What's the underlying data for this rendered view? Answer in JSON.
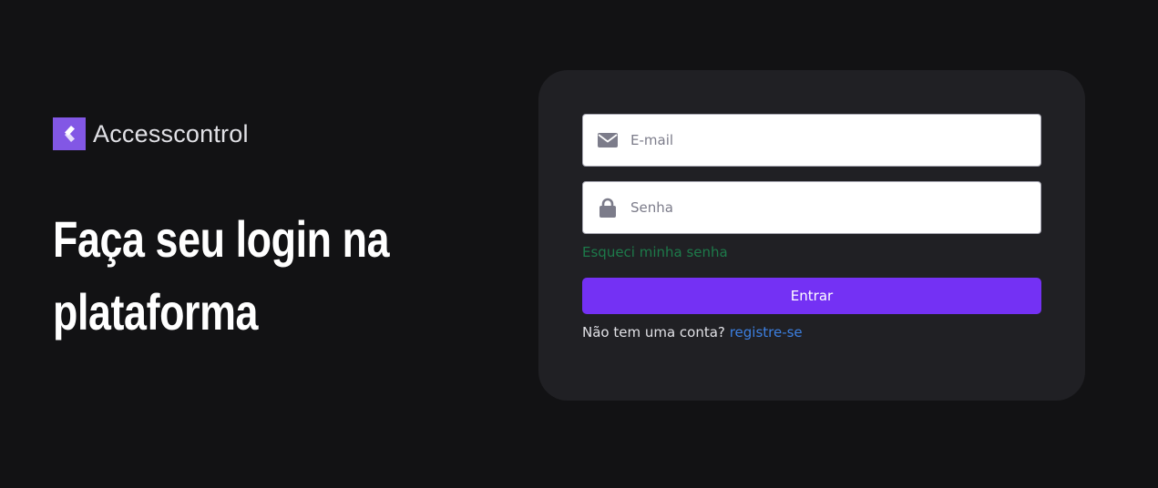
{
  "brand": {
    "name": "Accesscontrol",
    "logo_icon": "stylized-k-logo-icon",
    "logo_color": "#8257e5"
  },
  "hero": {
    "headline": "Faça seu login na plataforma"
  },
  "form": {
    "email": {
      "icon": "envelope-icon",
      "placeholder": "E-mail",
      "value": ""
    },
    "password": {
      "icon": "lock-icon",
      "placeholder": "Senha",
      "value": ""
    },
    "forgot_password_label": "Esqueci minha senha",
    "submit_label": "Entrar",
    "signup_prompt": "Não tem uma conta?",
    "signup_link_label": "registre-se"
  },
  "colors": {
    "background": "#121214",
    "card": "#202024",
    "accent": "#7431f4",
    "forgot_link": "#1d7a4a",
    "signup_link": "#3c7fe0"
  }
}
